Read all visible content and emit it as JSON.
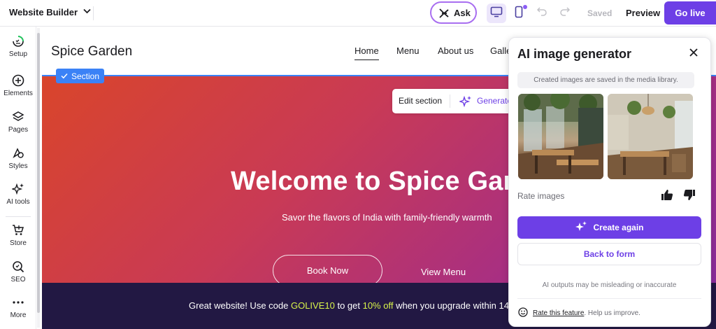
{
  "topbar": {
    "app_title": "Website Builder",
    "ask_label": "Ask",
    "saved_label": "Saved",
    "preview_label": "Preview",
    "golive_label": "Go live"
  },
  "sidebar": {
    "items": [
      {
        "label": "Setup",
        "icon": "setup-checklist-icon"
      },
      {
        "label": "Elements",
        "icon": "plus-circle-icon"
      },
      {
        "label": "Pages",
        "icon": "layers-icon"
      },
      {
        "label": "Styles",
        "icon": "palette-icon"
      },
      {
        "label": "AI tools",
        "icon": "sparkles-icon"
      },
      {
        "label": "Store",
        "icon": "cart-icon"
      },
      {
        "label": "SEO",
        "icon": "seo-search-icon"
      },
      {
        "label": "More",
        "icon": "more-dots-icon"
      }
    ]
  },
  "site": {
    "title": "Spice Garden",
    "nav": [
      "Home",
      "Menu",
      "About us",
      "Galle"
    ],
    "section_tag": "Section",
    "edit_section": "Edit section",
    "generate": "Generate",
    "hero_title": "Welcome to Spice Gard",
    "hero_subtitle": "Savor the flavors of India with family-friendly warmth",
    "book_now": "Book Now",
    "view_menu": "View Menu",
    "promo_prefix": "Great website! Use code ",
    "promo_code": "GOLIVE10",
    "promo_mid": " to get ",
    "promo_discount": "10% off",
    "promo_suffix": " when you upgrade within 14"
  },
  "ai_panel": {
    "title": "AI image generator",
    "note": "Created images are saved in the media library.",
    "rate_label": "Rate images",
    "create_again": "Create again",
    "back_to_form": "Back to form",
    "disclaimer": "AI outputs may be misleading or inaccurate",
    "rate_feature": "Rate this feature",
    "help_text": ". Help us improve."
  },
  "colors": {
    "brand": "#6d3fe6",
    "selection": "#3b82f6",
    "promo_bg": "#221843",
    "promo_code": "#d8f34a"
  }
}
